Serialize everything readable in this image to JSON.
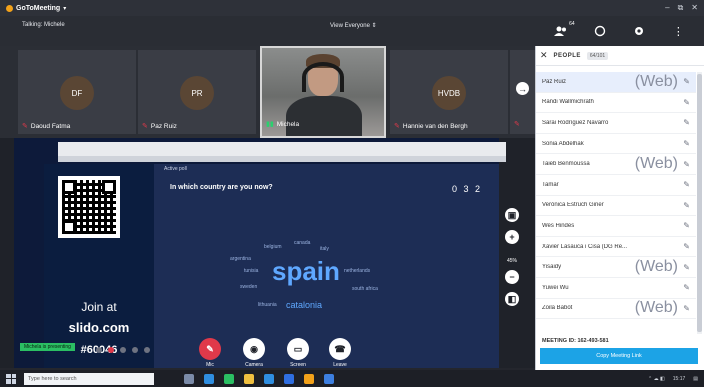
{
  "app": {
    "title": "GoToMeeting",
    "caret": "▾",
    "window_controls": [
      "–",
      "⧉",
      "✕"
    ]
  },
  "status": {
    "talking": "Talking: Michele",
    "view": "View Everyone ⇕"
  },
  "toolbar": {
    "people_count": "64",
    "icons": [
      "people-icon",
      "camera-icon",
      "settings-icon",
      "more-icon"
    ]
  },
  "participants": [
    {
      "initials": "DF",
      "name": "Daoud Fatma",
      "muted": true
    },
    {
      "initials": "PR",
      "name": "Paz Ruiz",
      "muted": true
    },
    {
      "initials": "",
      "name": "Michela",
      "muted": false,
      "video": true
    },
    {
      "initials": "HVDB",
      "name": "Hannie van den Bergh",
      "muted": true
    }
  ],
  "slido": {
    "active_poll": "Active poll",
    "question": "In which country are you now?",
    "count": "0 3 2",
    "join_at": "Join at",
    "join_url": "slido.com",
    "join_code": "#60046",
    "words": [
      {
        "text": "spain",
        "size": 26,
        "color": "#5fa8ff",
        "bold": true
      },
      {
        "text": "catalonia",
        "size": 9,
        "color": "#5fa8ff",
        "bold": false
      },
      {
        "text": "belgium",
        "size": 5,
        "color": "#9bb3e0",
        "bold": false
      },
      {
        "text": "canada",
        "size": 5,
        "color": "#9bb3e0",
        "bold": false
      },
      {
        "text": "italy",
        "size": 5,
        "color": "#9bb3e0",
        "bold": false
      },
      {
        "text": "argentina",
        "size": 5,
        "color": "#9bb3e0",
        "bold": false
      },
      {
        "text": "tunisia",
        "size": 5,
        "color": "#9bb3e0",
        "bold": false
      },
      {
        "text": "sweden",
        "size": 5,
        "color": "#9bb3e0",
        "bold": false
      },
      {
        "text": "netherlands",
        "size": 5,
        "color": "#9bb3e0",
        "bold": false
      },
      {
        "text": "south africa",
        "size": 5,
        "color": "#9bb3e0",
        "bold": false
      },
      {
        "text": "lithuania",
        "size": 5,
        "color": "#9bb3e0",
        "bold": false
      }
    ]
  },
  "zoom": "45%",
  "presenting": "Michela is presenting",
  "controls": [
    {
      "label": "Mic",
      "icon": "mic-icon"
    },
    {
      "label": "Camera",
      "icon": "camera-icon"
    },
    {
      "label": "Screen",
      "icon": "screen-icon"
    },
    {
      "label": "Leave",
      "icon": "leave-icon"
    }
  ],
  "panel": {
    "title": "PEOPLE",
    "tab": "64/101",
    "people": [
      {
        "name": "Paz Ruiz",
        "tag": "(Web)",
        "selected": true
      },
      {
        "name": "Randi Wallmichrath",
        "tag": "",
        "selected": false
      },
      {
        "name": "Sarai Rodríguez Navarro",
        "tag": "",
        "selected": false
      },
      {
        "name": "Sonia Abdelhak",
        "tag": "",
        "selected": false
      },
      {
        "name": "Taieb Benmoussa",
        "tag": "(Web)",
        "selected": false
      },
      {
        "name": "Tamar",
        "tag": "",
        "selected": false
      },
      {
        "name": "Verónica Estruch Giner",
        "tag": "",
        "selected": false
      },
      {
        "name": "Wes Hindes",
        "tag": "",
        "selected": false
      },
      {
        "name": "Xavier Lasauca i Cisa (DG Re...",
        "tag": "",
        "selected": false
      },
      {
        "name": "Yisaidy",
        "tag": "(Web)",
        "selected": false
      },
      {
        "name": "Yuwei Wu",
        "tag": "",
        "selected": false
      },
      {
        "name": "Zoila Babot",
        "tag": "(Web)",
        "selected": false
      }
    ],
    "meeting_id": "MEETING ID: 162-493-581",
    "copy_link": "Copy Meeting Link"
  },
  "taskbar": {
    "search_placeholder": "Type here to search",
    "time": "15:17"
  }
}
